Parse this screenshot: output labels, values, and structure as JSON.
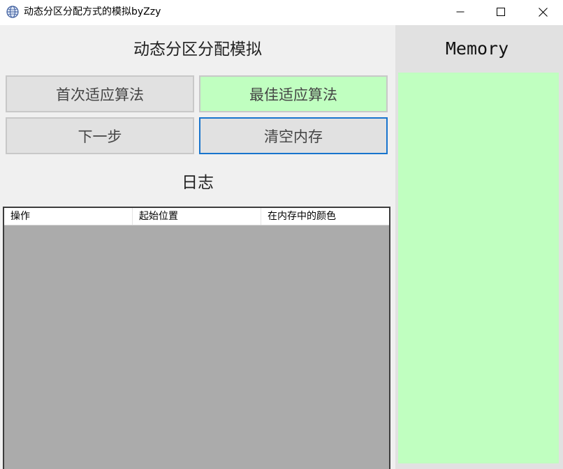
{
  "window": {
    "title": "动态分区分配方式的模拟byZzy",
    "icon": "app-globe-icon"
  },
  "controls": {
    "heading": "动态分区分配模拟",
    "first_fit_label": "首次适应算法",
    "best_fit_label": "最佳适应算法",
    "next_step_label": "下一步",
    "clear_memory_label": "清空内存",
    "best_fit_selected_color": "#c0ffc0"
  },
  "log": {
    "heading": "日志",
    "columns": [
      "操作",
      "起始位置",
      "在内存中的颜色"
    ],
    "rows": []
  },
  "memory": {
    "title": "Memory",
    "free_color": "#c0ffc0"
  }
}
